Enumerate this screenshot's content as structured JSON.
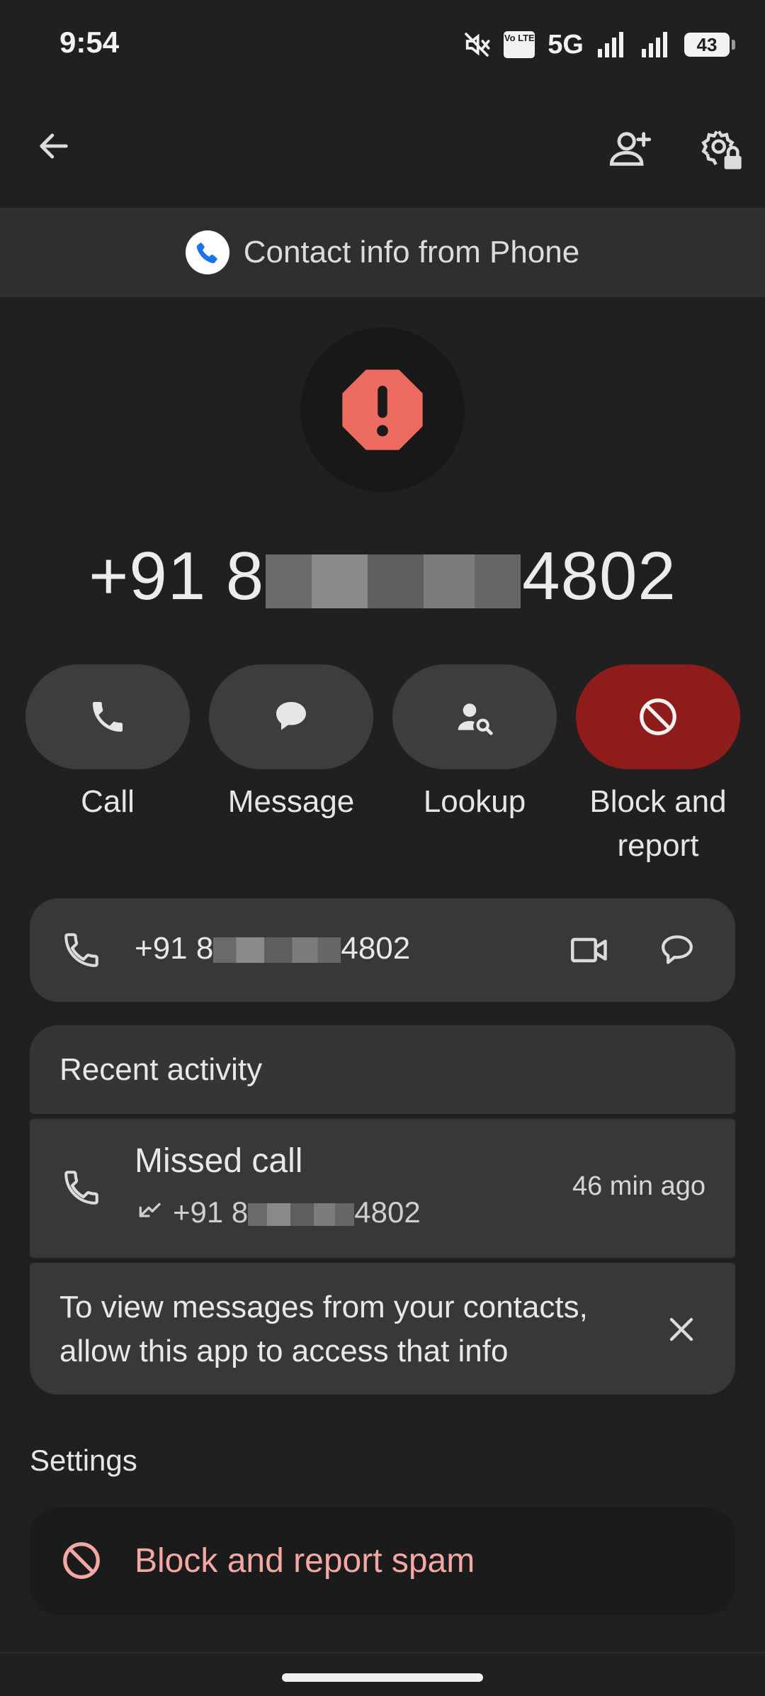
{
  "status_bar": {
    "time": "9:54",
    "network": "5G",
    "volte": "Vo LTE",
    "battery": "43"
  },
  "banner": {
    "text": "Contact info from Phone"
  },
  "contact": {
    "number_prefix": "+91 8",
    "number_suffix": "4802"
  },
  "actions": [
    {
      "label": "Call"
    },
    {
      "label": "Message"
    },
    {
      "label": "Lookup"
    },
    {
      "label": "Block and report"
    }
  ],
  "phone_row": {
    "prefix": "+91 8",
    "suffix": "4802"
  },
  "recent": {
    "title": "Recent activity",
    "item": {
      "type": "Missed call",
      "prefix": "+91 8",
      "suffix": "4802",
      "time": "46 min ago"
    }
  },
  "permission_notice": {
    "text": "To view messages from your contacts, allow this app to access that info"
  },
  "settings": {
    "title": "Settings",
    "block_label": "Block and report spam"
  },
  "colors": {
    "background": "#202020",
    "danger": "#8e1c1a",
    "alert_icon": "#ee6b62",
    "block_text": "#f4a8a4"
  }
}
